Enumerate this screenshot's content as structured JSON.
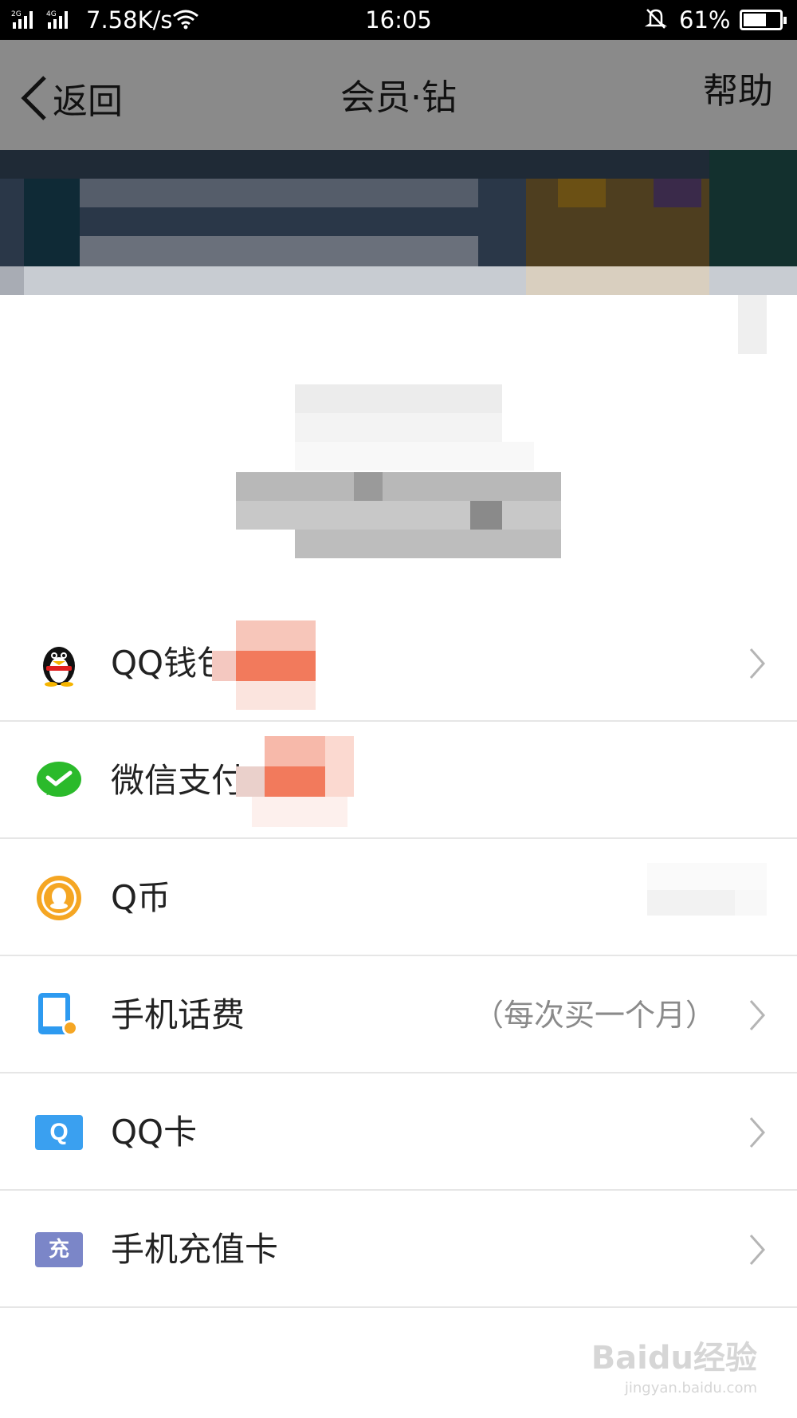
{
  "status_bar": {
    "network": "2G 4G",
    "speed": "7.58K/s",
    "time": "16:05",
    "battery": "61%",
    "battery_level": 0.61
  },
  "nav": {
    "back_label": "返回",
    "title": "会员·钻",
    "help_label": "帮助"
  },
  "payment_methods": [
    {
      "label": "QQ钱包",
      "note": "",
      "icon": "qq-penguin-icon"
    },
    {
      "label": "微信支付",
      "note": "",
      "icon": "wechat-pay-icon"
    },
    {
      "label": "Q币",
      "note": "",
      "icon": "q-coin-icon"
    },
    {
      "label": "手机话费",
      "note": "（每次买一个月）",
      "icon": "phone-bill-icon"
    },
    {
      "label": "QQ卡",
      "note": "",
      "icon": "qq-card-icon"
    },
    {
      "label": "手机充值卡",
      "note": "",
      "icon": "recharge-card-icon"
    }
  ],
  "icon_text": {
    "qq_card": "Q",
    "recharge_card": "充"
  },
  "watermark": {
    "main": "Baidu经验",
    "sub": "jingyan.baidu.com"
  },
  "colors": {
    "nav_bg": "#8a8a8a",
    "wechat_green": "#2bba2b",
    "qcoin_orange": "#f5a623",
    "phone_blue": "#2d9af0",
    "qqcard_blue": "#3aa0f0",
    "recharge_purple": "#7b86c8"
  }
}
